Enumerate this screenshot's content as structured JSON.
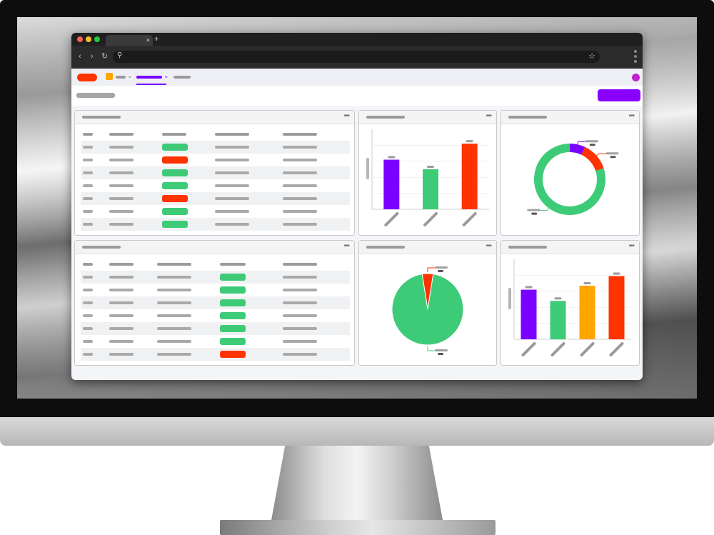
{
  "colors": {
    "purple": "#7a00ff",
    "green": "#3ecb78",
    "red": "#ff3300",
    "orange": "#ffa500",
    "accent": "#8a00ff",
    "avatar": "#c020d0"
  },
  "icons": {
    "tab_close": "×",
    "tab_new": "+",
    "back": "‹",
    "forward": "›",
    "reload": "↻",
    "search": "⚲",
    "star": "☆",
    "chevron": "⌄",
    "card_menu": "•••"
  },
  "tables": {
    "top": {
      "status_column": 2,
      "statuses": [
        "green",
        "red",
        "green",
        "green",
        "red",
        "green",
        "green"
      ]
    },
    "bottom": {
      "status_column": 3,
      "statuses": [
        "green",
        "green",
        "green",
        "green",
        "green",
        "green",
        "red"
      ]
    }
  },
  "chart_data": [
    {
      "type": "bar",
      "series_colors": [
        "#7a00ff",
        "#3ecb78",
        "#ff3300"
      ],
      "values": [
        62,
        50,
        82
      ],
      "ylim": [
        0,
        100
      ]
    },
    {
      "type": "pie",
      "variant": "donut",
      "slices": [
        {
          "value": 7,
          "color": "#7a00ff"
        },
        {
          "value": 13,
          "color": "#ff3300"
        },
        {
          "value": 80,
          "color": "#3ecb78"
        }
      ]
    },
    {
      "type": "pie",
      "slices": [
        {
          "value": 5,
          "color": "#ff3300"
        },
        {
          "value": 95,
          "color": "#3ecb78"
        }
      ]
    },
    {
      "type": "bar",
      "series_colors": [
        "#7a00ff",
        "#3ecb78",
        "#ffa500",
        "#ff3300"
      ],
      "values": [
        62,
        48,
        67,
        79
      ],
      "ylim": [
        0,
        100
      ]
    }
  ]
}
